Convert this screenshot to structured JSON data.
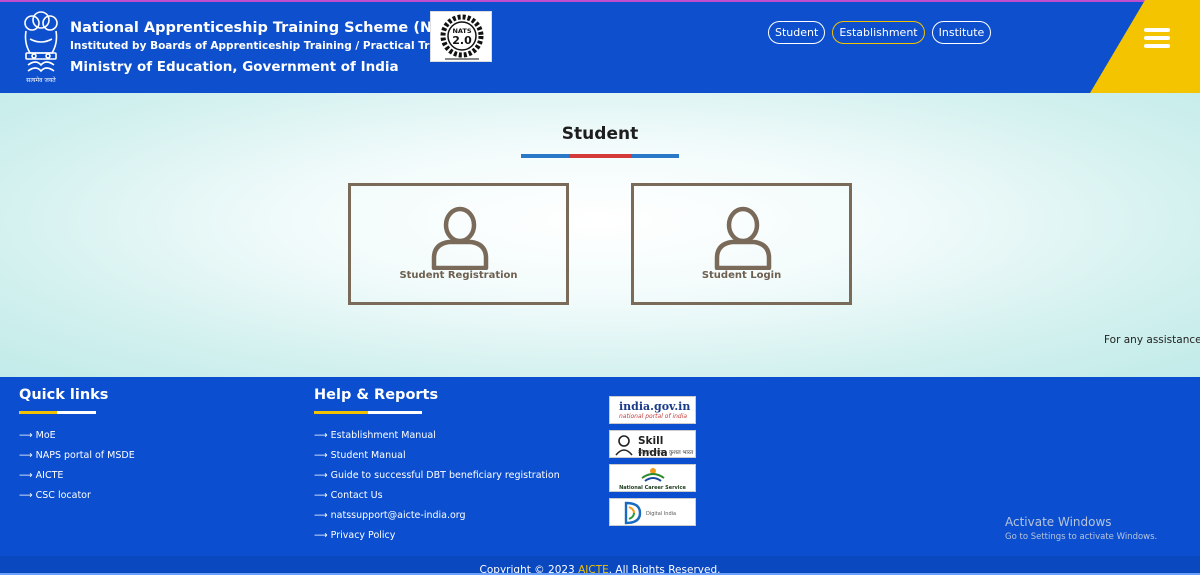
{
  "header": {
    "title_line1": "National Apprenticeship Training Scheme (NATS)",
    "title_line2": "Instituted by Boards of Apprenticeship Training / Practical Training",
    "title_line3": "Ministry of Education, Government of India",
    "logo_text": "NATS",
    "logo_version": "2.0",
    "nav": [
      "Student",
      "Establishment",
      "Institute"
    ],
    "active_nav": "Establishment"
  },
  "main": {
    "section_title": "Student",
    "cards": [
      {
        "label": "Student Registration"
      },
      {
        "label": "Student Login"
      }
    ],
    "assistance_text": "For any assistance"
  },
  "footer": {
    "quick_links": {
      "heading": "Quick links",
      "items": [
        "MoE",
        "NAPS portal of MSDE",
        "AICTE",
        "CSC locator"
      ]
    },
    "help_reports": {
      "heading": "Help & Reports",
      "items": [
        "Establishment Manual",
        "Student Manual",
        "Guide to successful DBT beneficiary registration",
        "Contact Us",
        "natssupport@aicte-india.org",
        "Privacy Policy"
      ]
    },
    "logos": {
      "india_gov": "india.gov.in",
      "india_gov_sub": "national portal of india",
      "skill_india": "Skill India",
      "skill_india_sub": "कौशल भारत - कुशल भारत",
      "ncs": "National Career Service",
      "digital_india": "Digital India"
    },
    "activate_windows": {
      "line1": "Activate Windows",
      "line2": "Go to Settings to activate Windows."
    },
    "copyright_prefix": "Copyright © 2023 ",
    "copyright_link": "AICTE",
    "copyright_suffix": ". All Rights Reserved."
  },
  "colors": {
    "header_blue": "#0d4fcc",
    "accent_yellow": "#f2c200",
    "card_border": "#7a6a5a",
    "footer_blue": "#0b4fd0"
  }
}
